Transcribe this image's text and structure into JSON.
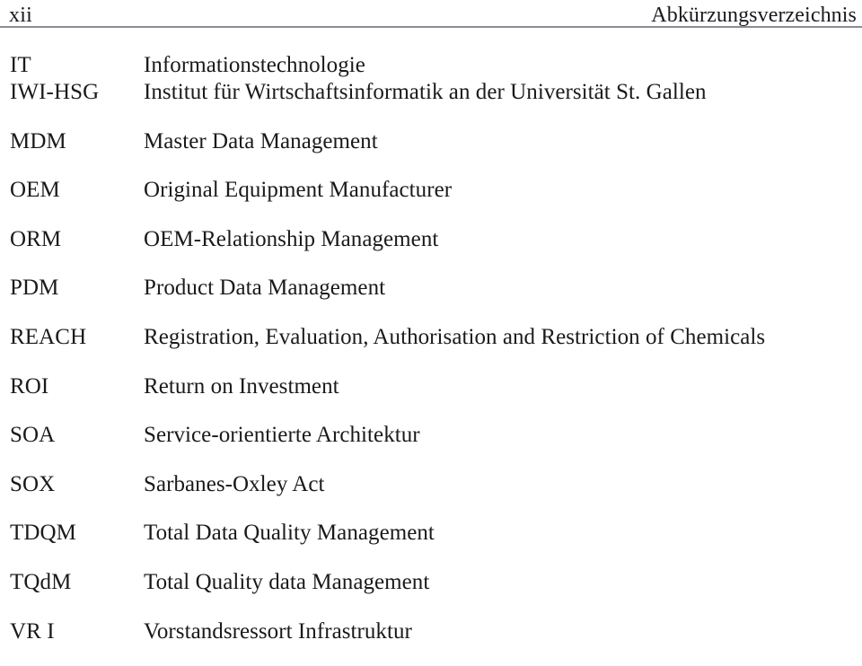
{
  "header": {
    "folio": "xii",
    "title": "Abkürzungsverzeichnis",
    "rule_color": "#8b8b93"
  },
  "abbreviations": [
    {
      "term": "IT",
      "definition": "Informationstechnologie"
    },
    {
      "term": "IWI-HSG",
      "definition": "Institut für Wirtschaftsinformatik an der Universität St. Gallen"
    },
    {
      "term": "MDM",
      "definition": "Master Data Management"
    },
    {
      "term": "OEM",
      "definition": "Original Equipment Manufacturer"
    },
    {
      "term": "ORM",
      "definition": "OEM-Relationship Management"
    },
    {
      "term": "PDM",
      "definition": "Product Data Management"
    },
    {
      "term": "REACH",
      "definition": "Registration, Evaluation, Authorisation and Restriction of Chemicals"
    },
    {
      "term": "ROI",
      "definition": "Return on Investment"
    },
    {
      "term": "SOA",
      "definition": "Service-orientierte Architektur"
    },
    {
      "term": "SOX",
      "definition": "Sarbanes-Oxley Act"
    },
    {
      "term": "TDQM",
      "definition": "Total Data Quality Management"
    },
    {
      "term": "TQdM",
      "definition": "Total Quality data Management"
    },
    {
      "term": "VR I",
      "definition": "Vorstandsressort Infrastruktur"
    }
  ]
}
